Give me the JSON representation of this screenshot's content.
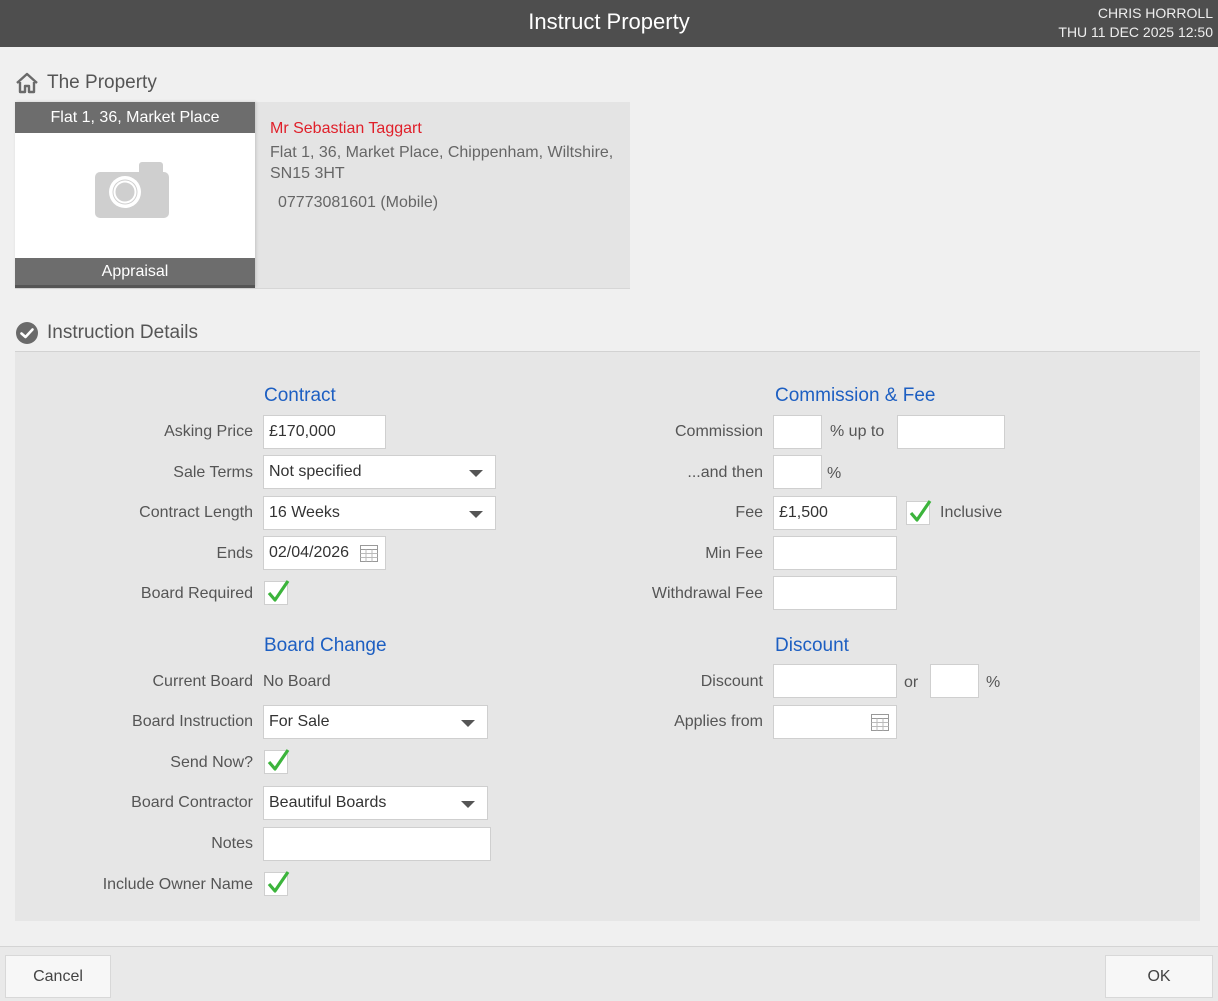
{
  "window": {
    "title": "Instruct Property",
    "user": "CHRIS HORROLL",
    "datetime": "THU 11 DEC 2025 12:50"
  },
  "property_section": {
    "heading": "The Property",
    "card": {
      "address_short": "Flat 1, 36, Market Place",
      "status": "Appraisal",
      "owner_name": "Mr Sebastian Taggart",
      "owner_address": "Flat 1, 36, Market Place, Chippenham, Wiltshire, SN15 3HT",
      "phone": "07773081601 (Mobile)"
    }
  },
  "instruction_section": {
    "heading": "Instruction Details"
  },
  "contract": {
    "title": "Contract",
    "asking_price_label": "Asking Price",
    "asking_price": "£170,000",
    "sale_terms_label": "Sale Terms",
    "sale_terms": "Not specified",
    "contract_length_label": "Contract Length",
    "contract_length": "16 Weeks",
    "ends_label": "Ends",
    "ends": "02/04/2026",
    "board_required_label": "Board Required",
    "board_required": true
  },
  "board_change": {
    "title": "Board Change",
    "current_board_label": "Current Board",
    "current_board": "No Board",
    "board_instruction_label": "Board Instruction",
    "board_instruction": "For Sale",
    "send_now_label": "Send Now?",
    "send_now": true,
    "board_contractor_label": "Board Contractor",
    "board_contractor": "Beautiful Boards",
    "notes_label": "Notes",
    "notes": "",
    "include_owner_label": "Include Owner Name",
    "include_owner": true
  },
  "commission": {
    "title": "Commission & Fee",
    "commission_label": "Commission",
    "commission_pct": "",
    "up_to_text": "% up to",
    "up_to": "",
    "and_then_label": "...and then",
    "and_then_pct": "",
    "pct_symbol": "%",
    "fee_label": "Fee",
    "fee": "£1,500",
    "inclusive_label": "Inclusive",
    "inclusive": true,
    "min_fee_label": "Min Fee",
    "min_fee": "",
    "withdrawal_fee_label": "Withdrawal Fee",
    "withdrawal_fee": ""
  },
  "discount": {
    "title": "Discount",
    "discount_label": "Discount",
    "discount_amount": "",
    "or_text": "or",
    "discount_pct": "",
    "pct_symbol": "%",
    "applies_from_label": "Applies from",
    "applies_from": ""
  },
  "footer": {
    "cancel_label": "Cancel",
    "ok_label": "OK"
  },
  "colors": {
    "titlebar": "#4e4e4e",
    "group_title": "#1d5fc2",
    "owner_name": "#e0202a",
    "check": "#3cb43c"
  }
}
